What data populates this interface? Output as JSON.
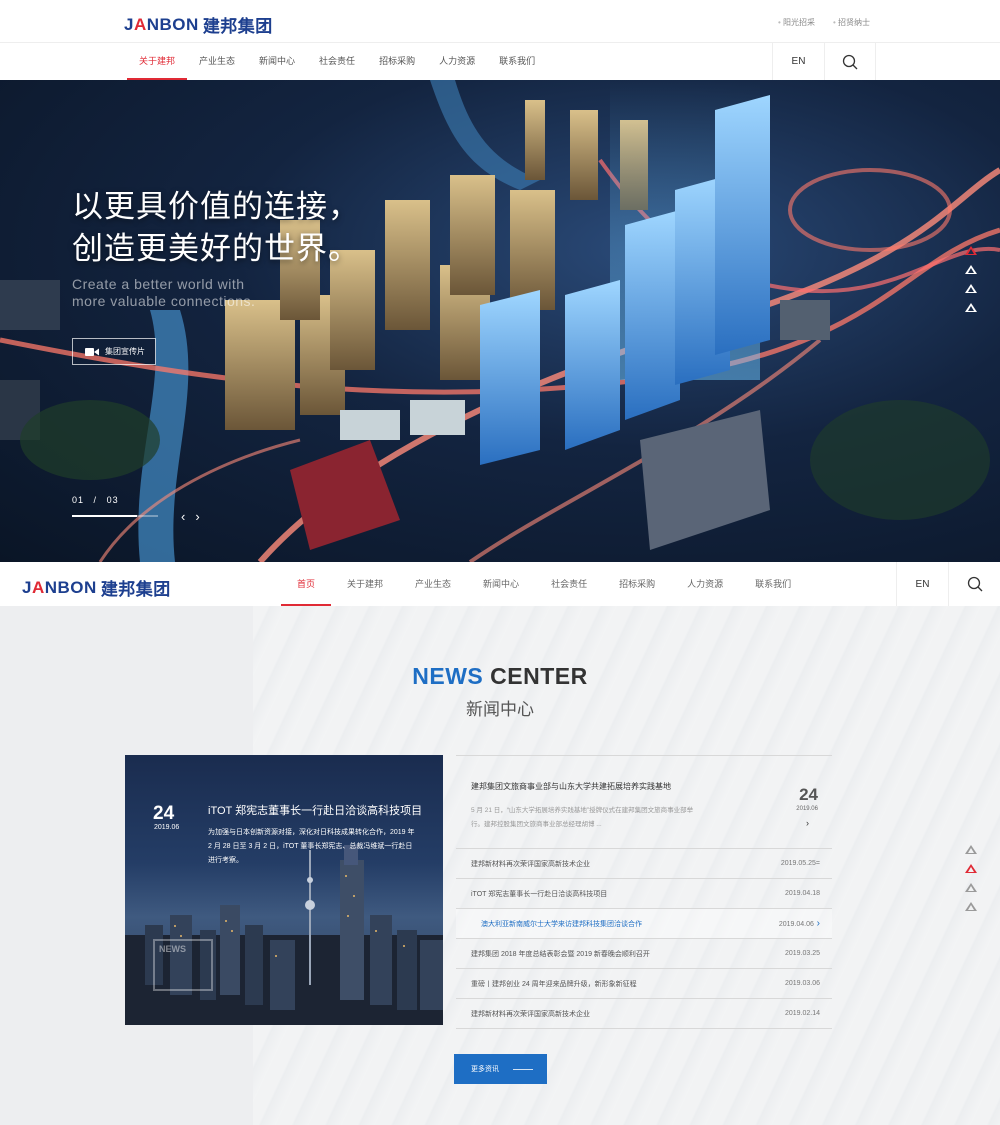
{
  "brand": {
    "logo_en_pre": "J",
    "logo_en_a": "A",
    "logo_en_post": "NBON",
    "logo_cn": "建邦集团"
  },
  "top_links": [
    "阳光招采",
    "招贤纳士"
  ],
  "nav": {
    "items": [
      "关于建邦",
      "产业生态",
      "新闻中心",
      "社会责任",
      "招标采购",
      "人力资源",
      "联系我们"
    ],
    "lang": "EN"
  },
  "hero": {
    "title_line1": "以更具价值的连接，",
    "title_line2": "创造更美好的世界。",
    "sub_line1": "Create a better world with",
    "sub_line2": "more valuable connections.",
    "video_label": "集团宣传片",
    "counter_current": "01",
    "counter_sep": "/",
    "counter_total": "03",
    "progress": 0.75,
    "prev": "‹",
    "next": "›",
    "pager_active": 0,
    "pager_count": 4
  },
  "nav2": {
    "items": [
      "首页",
      "关于建邦",
      "产业生态",
      "新闻中心",
      "社会责任",
      "招标采购",
      "人力资源",
      "联系我们"
    ],
    "lang": "EN"
  },
  "news": {
    "heading_colored": "NEWS",
    "heading_rest": " CENTER",
    "subheading": "新闻中心",
    "feature": {
      "day": "24",
      "month": "2019.06",
      "title": "iTOT 郑宪志董事长一行赴日洽谈高科技项目",
      "desc": "为加强与日本创新资源对接，深化对日科技成果转化合作，2019 年 2 月 28 日至 3 月 2 日，iTOT 董事长郑宪志、总裁冯维斌一行赴日进行考察。",
      "badge": "NEWS"
    },
    "top_item": {
      "title": "建邦集团文旅商事业部与山东大学共建拓展培养实践基地",
      "desc": "5 月 21 日，“山东大学拓展培养实践基地”授牌仪式在建邦集团文旅商事业部举行。建邦控股集团文旅商事业部总经理胡博 ...",
      "day": "24",
      "ym": "2019.06",
      "arrow": "›"
    },
    "items": [
      {
        "title": "建邦新材料再次荣评国家高新技术企业",
        "date": "2019.05.25="
      },
      {
        "title": "iTOT 郑宪志董事长一行赴日洽谈高科技项目",
        "date": "2019.04.18"
      },
      {
        "title": "澳大利亚新南威尔士大学来访建邦科技集团洽谈合作",
        "date": "2019.04.06"
      },
      {
        "title": "建邦集团 2018 年度总结表彰会暨 2019 新春晚会顺利召开",
        "date": "2019.03.25"
      },
      {
        "title": "重磅丨建邦创业 24 周年迎来品牌升级，新形象新征程",
        "date": "2019.03.06"
      },
      {
        "title": "建邦新材料再次荣评国家高新技术企业",
        "date": "2019.02.14"
      }
    ],
    "highlight_index": 2,
    "more_label": "更多资讯",
    "pager_active": 1,
    "pager_count": 4
  },
  "colors": {
    "accent_red": "#e02a35",
    "brand_blue": "#1d3f8f",
    "link_blue": "#1e6ec4"
  }
}
